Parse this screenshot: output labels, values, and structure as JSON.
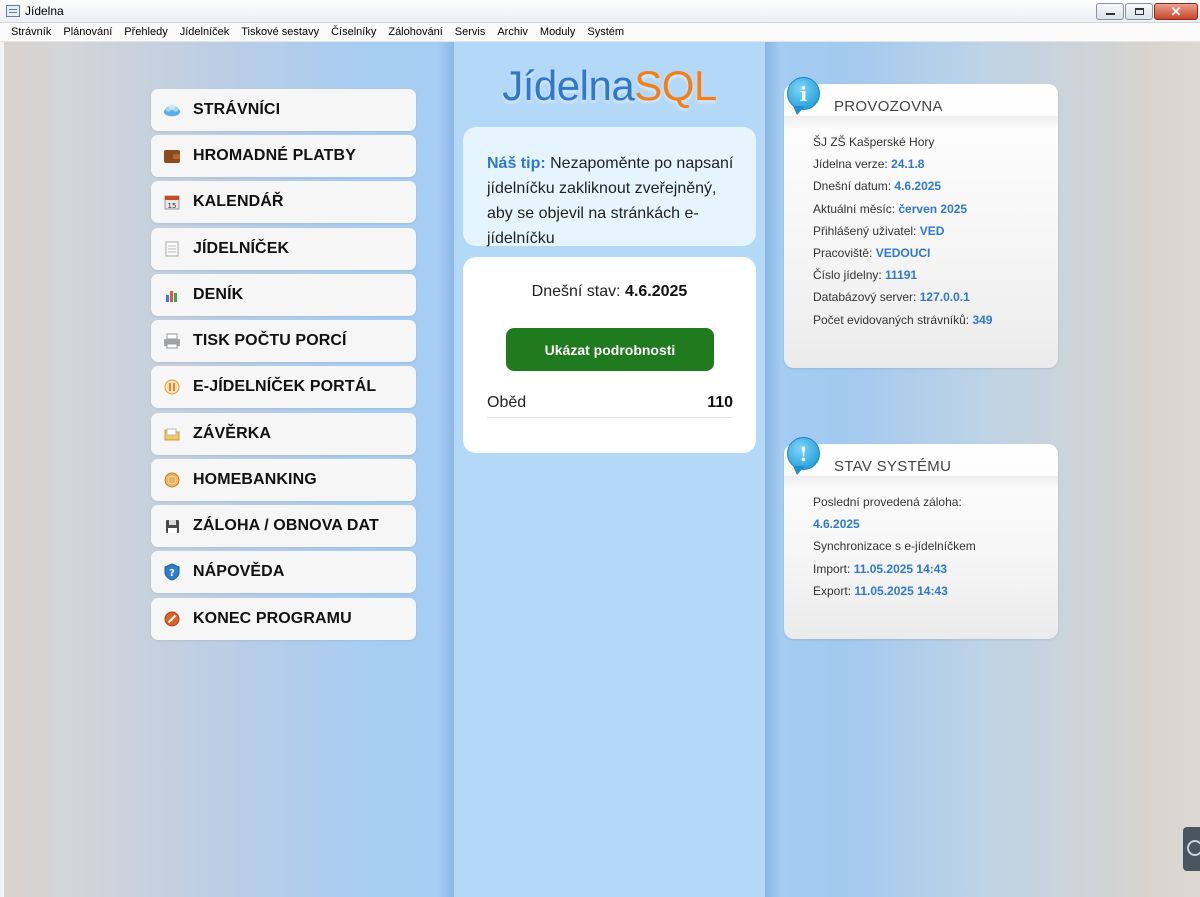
{
  "window": {
    "title": "Jídelna",
    "icon": "app-window-icon",
    "controls": [
      "minimize-icon",
      "maximize-icon",
      "close-icon"
    ]
  },
  "menu": [
    "Strávník",
    "Plánování",
    "Přehledy",
    "Jídelníček",
    "Tiskové sestavy",
    "Číselníky",
    "Zálohování",
    "Servis",
    "Archiv",
    "Moduly",
    "Systém"
  ],
  "nav": [
    {
      "label": "STRÁVNÍCI",
      "icon": "people-icon"
    },
    {
      "label": "HROMADNÉ PLATBY",
      "icon": "wallet-icon"
    },
    {
      "label": "KALENDÁŘ",
      "icon": "calendar-icon"
    },
    {
      "label": "JÍDELNÍČEK",
      "icon": "document-icon"
    },
    {
      "label": "DENÍK",
      "icon": "chart-icon"
    },
    {
      "label": "TISK POČTU PORCÍ",
      "icon": "printer-icon"
    },
    {
      "label": "E-JÍDELNÍČEK PORTÁL",
      "icon": "cutlery-icon"
    },
    {
      "label": "ZÁVĚRKA",
      "icon": "folder-icon"
    },
    {
      "label": "HOMEBANKING",
      "icon": "coin-icon"
    },
    {
      "label": "ZÁLOHA / OBNOVA DAT",
      "icon": "floppy-icon"
    },
    {
      "label": "NÁPOVĚDA",
      "icon": "help-shield-icon"
    },
    {
      "label": "KONEC PROGRAMU",
      "icon": "exit-icon"
    }
  ],
  "logo": {
    "part1": "Jídelna",
    "part2": "SQL"
  },
  "tip": {
    "heading": "Náš tip:",
    "text": "Nezapoměnte po napsaní jídelníčku zakliknout zveřejněný, aby se objevil na stránkách e-jídelníčku"
  },
  "status": {
    "label": "Dnešní stav:",
    "date": "4.6.2025",
    "button": "Ukázat podrobnosti",
    "meals": [
      {
        "name": "Oběd",
        "count": "110"
      }
    ]
  },
  "provozovna": {
    "badge": "i",
    "title": "PROVOZOVNA",
    "name": "ŠJ ZŠ Kašperské Hory",
    "rows": [
      {
        "label": "Jídelna verze:",
        "value": "24.1.8"
      },
      {
        "label": "Dnešní datum:",
        "value": "4.6.2025"
      },
      {
        "label": "Aktuální měsíc:",
        "value": "červen 2025"
      },
      {
        "label": "Přihlášený uživatel:",
        "value": "VED"
      },
      {
        "label": "Pracoviště:",
        "value": "VEDOUCI"
      },
      {
        "label": "Číslo jídelny:",
        "value": "11191"
      },
      {
        "label": "Databázový server:",
        "value": "127.0.0.1"
      },
      {
        "label": "Počet evidovaných strávníků:",
        "value": "349"
      }
    ]
  },
  "stav": {
    "badge": "!",
    "title": "STAV SYSTÉMU",
    "backup_label": "Poslední provedená záloha:",
    "backup_value": "4.6.2025",
    "sync_label": "Synchronizace s e-jídelníčkem",
    "import_label": "Import:",
    "import_value": "11.05.2025 14:43",
    "export_label": "Export:",
    "export_value": "11.05.2025 14:43"
  }
}
